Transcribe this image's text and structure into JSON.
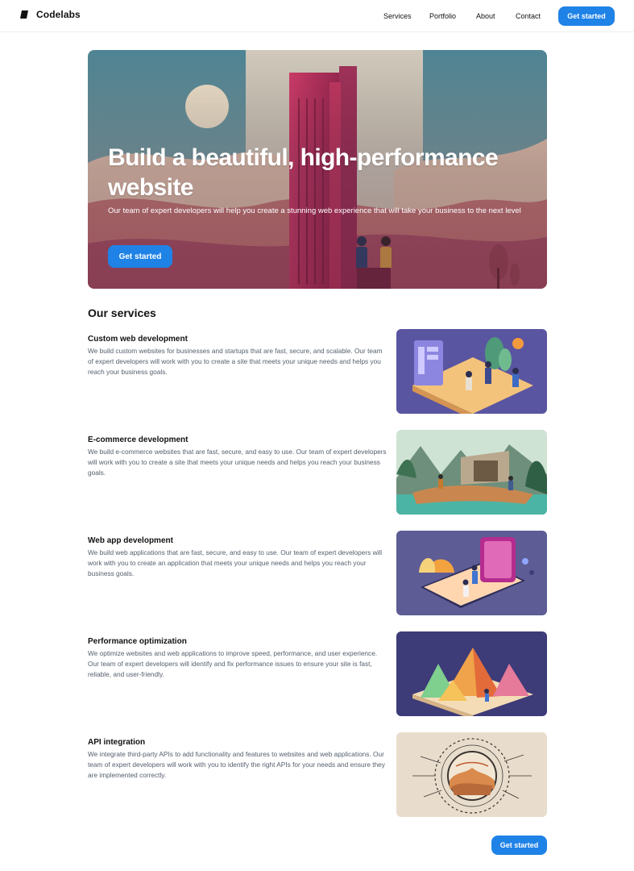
{
  "header": {
    "brand": "Codelabs",
    "nav": [
      "Services",
      "Portfolio",
      "About",
      "Contact"
    ],
    "cta_label": "Get started"
  },
  "hero": {
    "title": "Build a beautiful, high-performance website",
    "subtitle": "Our team of expert developers will help you create a stunning web experience that will take your business to the next level",
    "cta_label": "Get started"
  },
  "services": {
    "title": "Our services",
    "items": [
      {
        "title": "Custom web development",
        "description": "We build custom websites for businesses and startups that are fast, secure, and scalable. Our team of expert developers will work with you to create a site that meets your unique needs and helps you reach your business goals."
      },
      {
        "title": "E-commerce development",
        "description": "We build e-commerce websites that are fast, secure, and easy to use. Our team of expert developers will work with you to create a site that meets your unique needs and helps you reach your business goals."
      },
      {
        "title": "Web app development",
        "description": "We build web applications that are fast, secure, and easy to use. Our team of expert developers will work with you to create an application that meets your unique needs and helps you reach your business goals."
      },
      {
        "title": "Performance optimization",
        "description": "We optimize websites and web applications to improve speed, performance, and user experience. Our team of expert developers will identify and fix performance issues to ensure your site is fast, reliable, and user-friendly."
      },
      {
        "title": "API integration",
        "description": "We integrate third-party APIs to add functionality and features to websites and web applications. Our team of expert developers will work with you to identify the right APIs for your needs and ensure they are implemented correctly."
      }
    ],
    "cta_label": "Get started"
  },
  "colors": {
    "accent": "#1f82e6",
    "text": "#121212",
    "muted": "#55606d"
  }
}
